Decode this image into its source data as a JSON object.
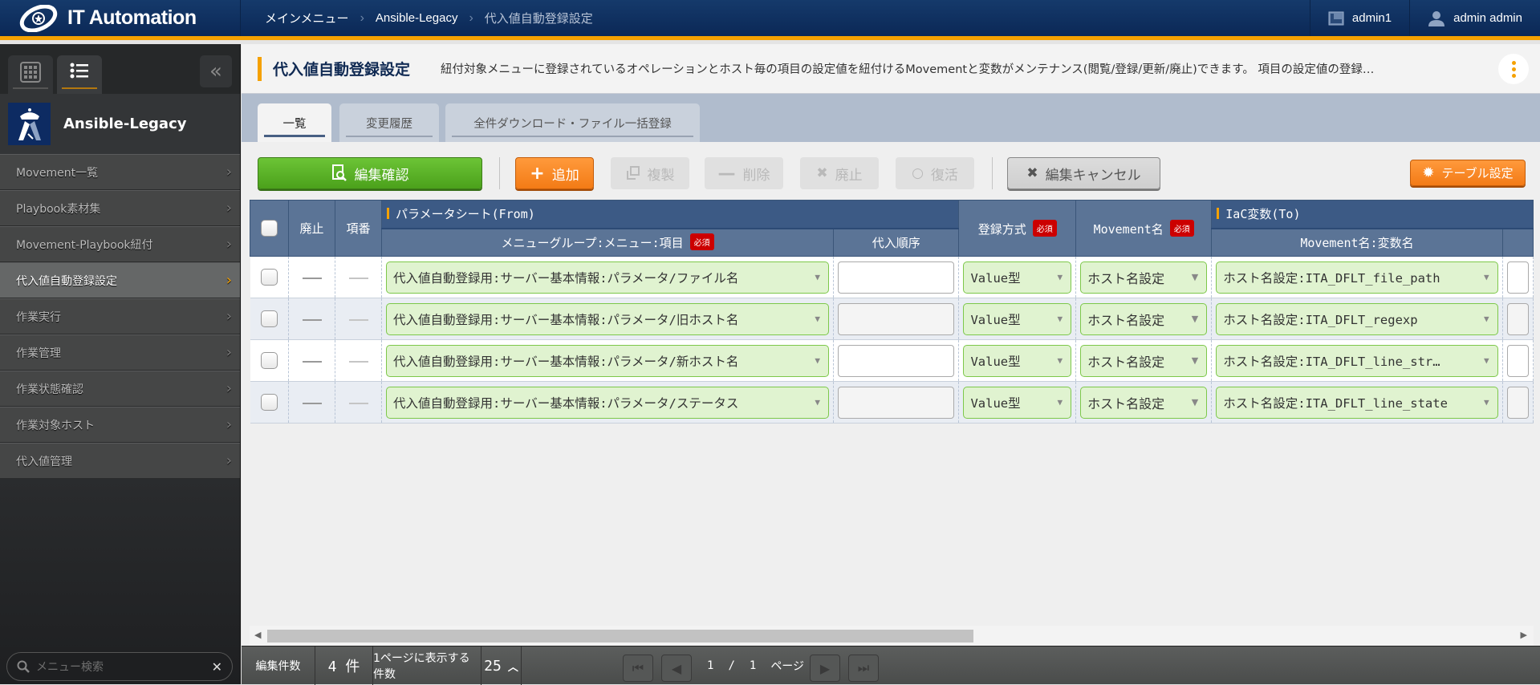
{
  "header": {
    "app_name": "IT Automation",
    "breadcrumb": [
      "メインメニュー",
      "Ansible-Legacy",
      "代入値自動登録設定"
    ],
    "workspace": "admin1",
    "user": "admin admin"
  },
  "sidebar": {
    "app_title": "Ansible-Legacy",
    "items": [
      {
        "label": "Movement一覧",
        "active": false
      },
      {
        "label": "Playbook素材集",
        "active": false
      },
      {
        "label": "Movement-Playbook紐付",
        "active": false
      },
      {
        "label": "代入値自動登録設定",
        "active": true
      },
      {
        "label": "作業実行",
        "active": false
      },
      {
        "label": "作業管理",
        "active": false
      },
      {
        "label": "作業状態確認",
        "active": false
      },
      {
        "label": "作業対象ホスト",
        "active": false
      },
      {
        "label": "代入値管理",
        "active": false
      }
    ],
    "search_placeholder": "メニュー検索"
  },
  "page": {
    "title": "代入値自動登録設定",
    "description": "紐付対象メニューに登録されているオペレーションとホスト毎の項目の設定値を紐付けるMovementと変数がメンテナンス(閲覧/登録/更新/廃止)できます。 項目の設定値の登録…",
    "tabs": [
      "一覧",
      "変更履歴",
      "全件ダウンロード・ファイル一括登録"
    ]
  },
  "toolbar": {
    "confirm": "編集確認",
    "add": "追加",
    "duplicate": "複製",
    "delete": "削除",
    "discard": "廃止",
    "restore": "復活",
    "cancel": "編集キャンセル",
    "table_settings": "テーブル設定"
  },
  "table": {
    "headers": {
      "discard": "廃止",
      "item_no": "項番",
      "group_from": "パラメータシート(From)",
      "menu_item": "メニューグループ:メニュー:項目",
      "order": "代入順序",
      "reg_method": "登録方式",
      "movement": "Movement名",
      "group_to": "IaC変数(To)",
      "movement_var": "Movement名:変数名",
      "required": "必須"
    },
    "rows": [
      {
        "menu_item": "代入値自動登録用:サーバー基本情報:パラメータ/ファイル名",
        "order": "",
        "reg_method": "Value型",
        "movement": "ホスト名設定",
        "movement_var": "ホスト名設定:ITA_DFLT_file_path"
      },
      {
        "menu_item": "代入値自動登録用:サーバー基本情報:パラメータ/旧ホスト名",
        "order": "",
        "reg_method": "Value型",
        "movement": "ホスト名設定",
        "movement_var": "ホスト名設定:ITA_DFLT_regexp"
      },
      {
        "menu_item": "代入値自動登録用:サーバー基本情報:パラメータ/新ホスト名",
        "order": "",
        "reg_method": "Value型",
        "movement": "ホスト名設定",
        "movement_var": "ホスト名設定:ITA_DFLT_line_str…"
      },
      {
        "menu_item": "代入値自動登録用:サーバー基本情報:パラメータ/ステータス",
        "order": "",
        "reg_method": "Value型",
        "movement": "ホスト名設定",
        "movement_var": "ホスト名設定:ITA_DFLT_line_state"
      }
    ]
  },
  "footer": {
    "edit_count_label": "編集件数",
    "edit_count": "4 件",
    "per_page_label": "1ページに表示する件数",
    "per_page": "25",
    "current_page": "1",
    "page_sep": "/",
    "total_pages": "1",
    "page_unit": "ページ"
  },
  "colors": {
    "accent": "#f5a100",
    "header_bg": "#0b2856",
    "primary_green": "#4ba11b",
    "primary_orange": "#f37b16",
    "required_badge": "#cc0000"
  }
}
